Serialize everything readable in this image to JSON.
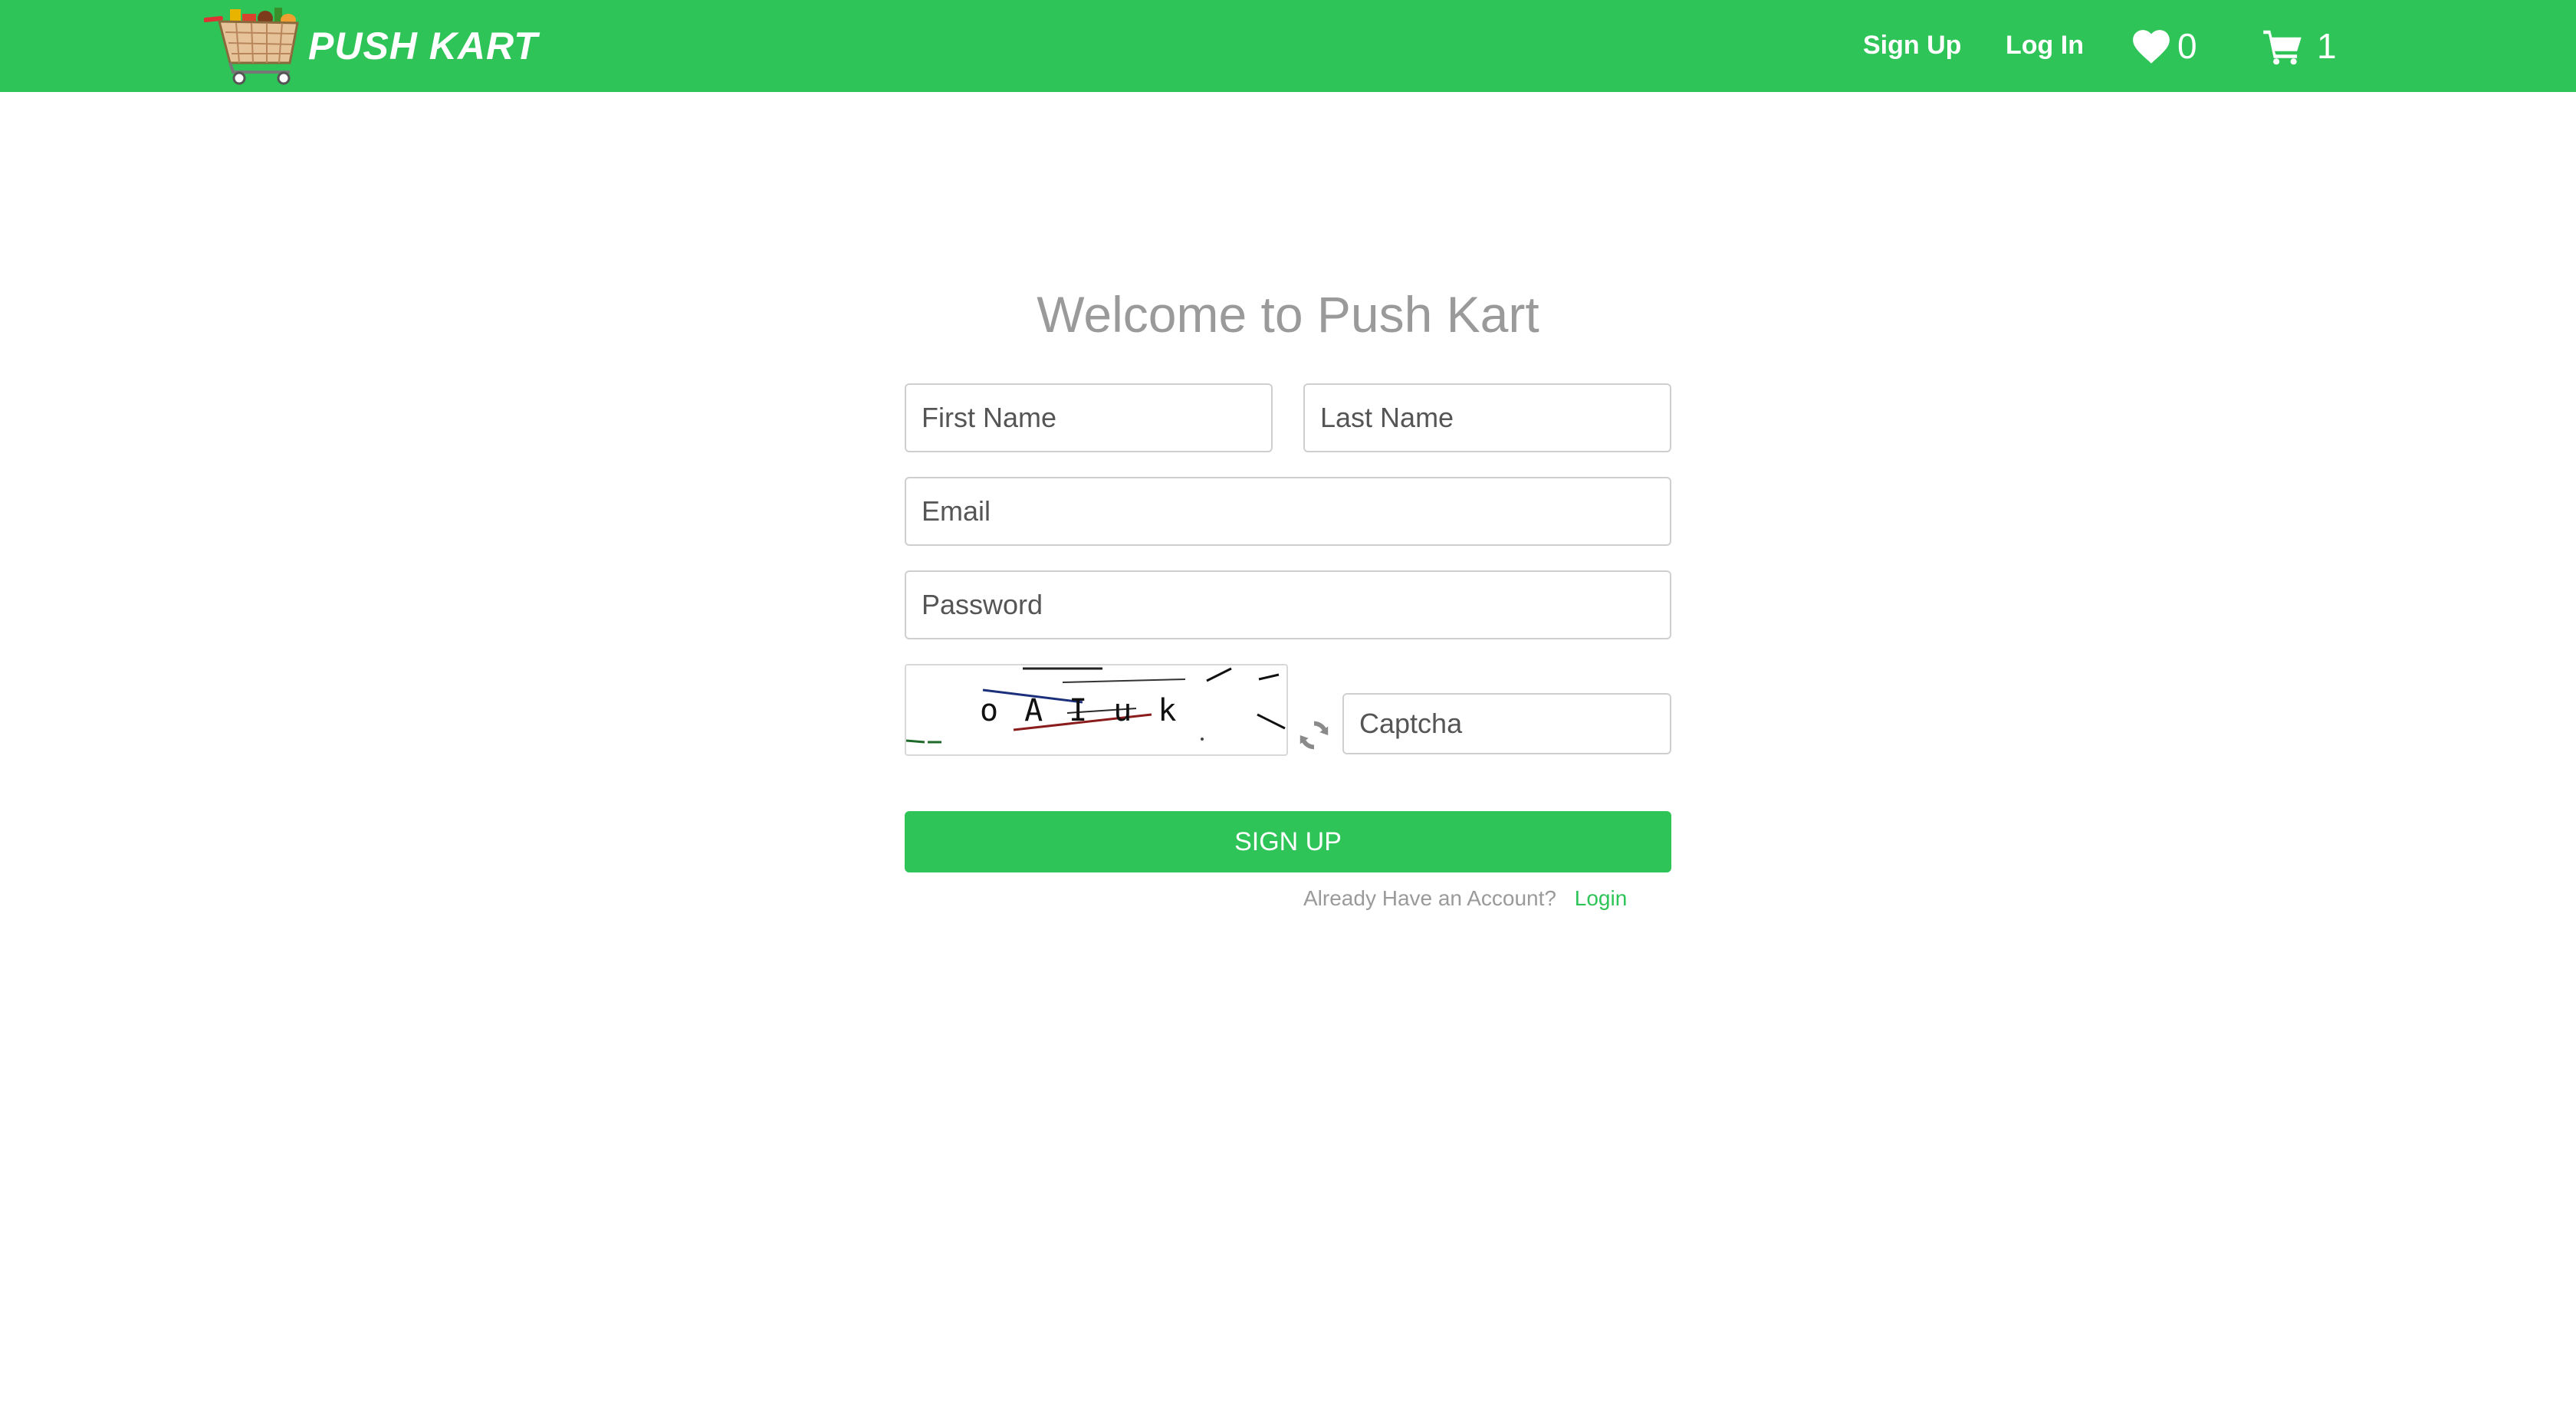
{
  "navbar": {
    "brand": "PUSH KART",
    "signup_link": "Sign Up",
    "login_link": "Log In",
    "wishlist_count": "0",
    "cart_count": "1",
    "icons": [
      "cart-logo",
      "heart-icon",
      "cart-icon"
    ],
    "bg_color": "#2ec458"
  },
  "form": {
    "title": "Welcome to Push Kart",
    "first_name_placeholder": "First Name",
    "last_name_placeholder": "Last Name",
    "email_placeholder": "Email",
    "password_placeholder": "Password",
    "captcha_placeholder": "Captcha",
    "captcha_text": "oAIuk",
    "submit_label": "SIGN UP",
    "account_prompt": "Already Have an Account?",
    "login_link": "Login",
    "accent_color": "#2ec458"
  }
}
